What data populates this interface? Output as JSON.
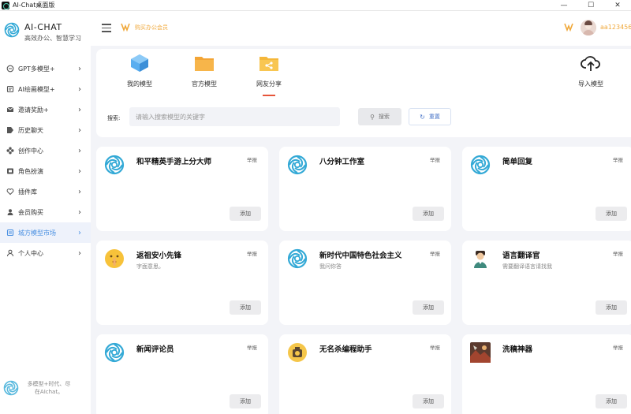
{
  "window": {
    "title": "AI-Chat桌面版",
    "controls": [
      "—",
      "☐",
      "✕"
    ]
  },
  "brand": {
    "name": "AI-CHAT",
    "slogan": "高效办公、智慧学习"
  },
  "sidebar": {
    "items": [
      {
        "label": "GPT多模型+",
        "icon": "chat-icon"
      },
      {
        "label": "AI绘画模型+",
        "icon": "image-icon"
      },
      {
        "label": "邀请奖励+",
        "icon": "mail-icon"
      },
      {
        "label": "历史聊天",
        "icon": "tag-icon"
      },
      {
        "label": "创作中心",
        "icon": "apps-icon"
      },
      {
        "label": "角色扮演",
        "icon": "folder-icon"
      },
      {
        "label": "插件库",
        "icon": "heart-icon"
      },
      {
        "label": "会员购买",
        "icon": "user-icon"
      },
      {
        "label": "城方模型市场",
        "icon": "store-icon",
        "active": true
      },
      {
        "label": "个人中心",
        "icon": "person-icon"
      }
    ],
    "footer": "多模型+时代、尽在AIchat。"
  },
  "header": {
    "vip_link": "购买办公会员",
    "username": "aa123456"
  },
  "tabs": [
    {
      "label": "我的模型",
      "icon": "cube-icon"
    },
    {
      "label": "官方模型",
      "icon": "folder-icon"
    },
    {
      "label": "网友分享",
      "icon": "share-folder-icon",
      "active": true
    }
  ],
  "import": {
    "label": "导入模型",
    "icon": "cloud-upload-icon"
  },
  "search": {
    "label": "搜索:",
    "placeholder": "请输入搜索模型的关键字",
    "search_label": "搜索",
    "reset_label": "重置"
  },
  "cards": [
    {
      "name": "和平精英手游上分大师",
      "desc": "",
      "tag": "举报",
      "add": "添加",
      "icon": "openai-icon"
    },
    {
      "name": "八分钟工作室",
      "desc": "",
      "tag": "举报",
      "add": "添加",
      "icon": "openai-icon"
    },
    {
      "name": "简单回复",
      "desc": "",
      "tag": "举报",
      "add": "添加",
      "icon": "openai-icon"
    },
    {
      "name": "返祖安小先锋",
      "desc": "字面意思。",
      "tag": "举报",
      "add": "添加",
      "icon": "shush-emoji-icon"
    },
    {
      "name": "新时代中国特色社会主义",
      "desc": "我问你答",
      "tag": "举报",
      "add": "添加",
      "icon": "openai-icon"
    },
    {
      "name": "语言翻译官",
      "desc": "需要翻译语言请找我",
      "tag": "举报",
      "add": "添加",
      "icon": "translator-avatar-icon"
    },
    {
      "name": "新闻评论员",
      "desc": "",
      "tag": "举报",
      "add": "添加",
      "icon": "openai-icon"
    },
    {
      "name": "无名杀编程助手",
      "desc": "",
      "tag": "举报",
      "add": "添加",
      "icon": "game-avatar-icon"
    },
    {
      "name": "洗稿神器",
      "desc": "",
      "tag": "举报",
      "add": "添加",
      "icon": "game-art-icon"
    }
  ],
  "colors": {
    "accent": "#4a90e2",
    "vip": "#f0a83a",
    "active_underline": "#e6553a",
    "logo": "#3aaed8"
  }
}
